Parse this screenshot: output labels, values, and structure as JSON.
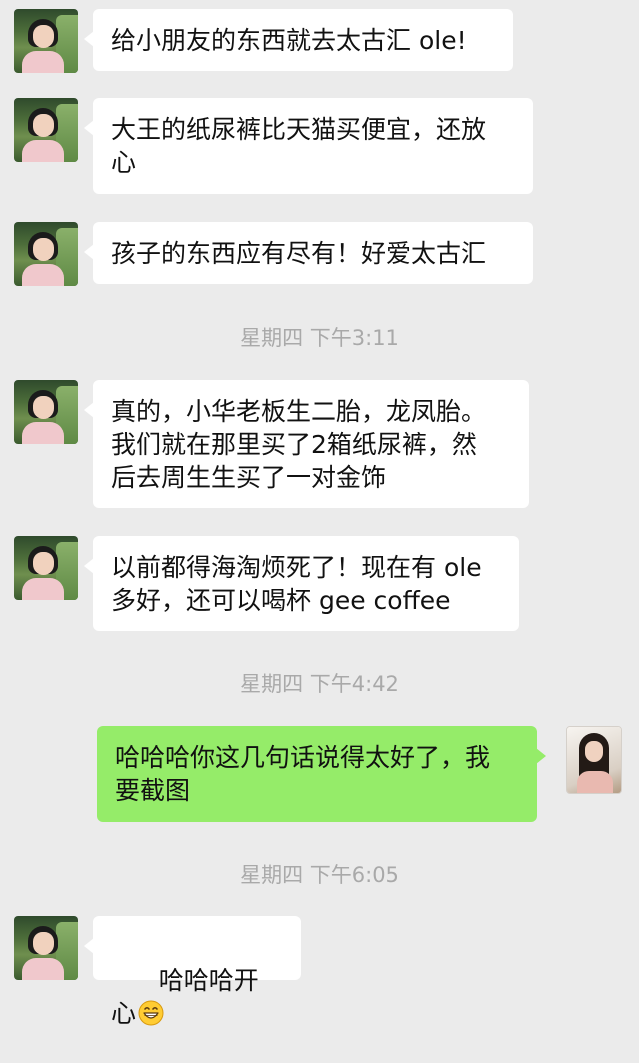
{
  "messages": [
    {
      "text": "给小朋友的东西就去太古汇 ole!"
    },
    {
      "text": "大王的纸尿裤比天猫买便宜，还放\n心"
    },
    {
      "text": "孩子的东西应有尽有！好爱太古汇"
    },
    {
      "text": "真的，小华老板生二胎，龙凤胎。\n我们就在那里买了2箱纸尿裤，然\n后去周生生买了一对金饰"
    },
    {
      "text": "以前都得海淘烦死了！现在有 ole\n多好，还可以喝杯 gee coffee"
    },
    {
      "text": "哈哈哈你这几句话说得太好了，我\n要截图"
    },
    {
      "text": "哈哈哈开心"
    }
  ],
  "timestamps": {
    "t1": "星期四 下午3:11",
    "t2": "星期四 下午4:42",
    "t3": "星期四 下午6:05"
  },
  "colors": {
    "background": "#ebebeb",
    "incoming_bubble": "#ffffff",
    "outgoing_bubble": "#95ec69",
    "timestamp_text": "#a9a9a9"
  },
  "icons": {
    "last_message_emoji": "grinning-face-emoji"
  }
}
